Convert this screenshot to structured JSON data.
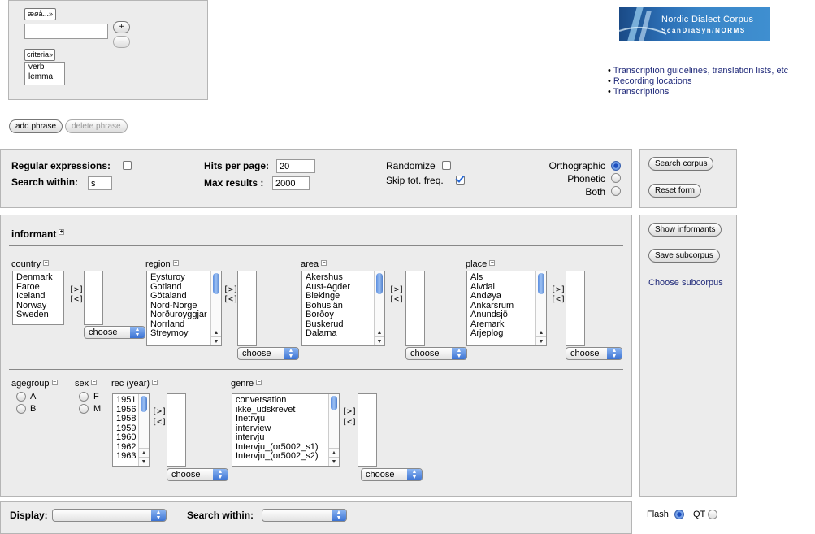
{
  "top": {
    "chars_button": "æøå...»",
    "plus": "+",
    "minus": "−",
    "criteria_button": "criteria»",
    "criteria_items": [
      "verb",
      "lemma"
    ],
    "add_phrase": "add phrase",
    "delete_phrase": "delete phrase"
  },
  "logo": {
    "title": "Nordic Dialect Corpus",
    "subtitle": "ScanDiaSyn/NORMS"
  },
  "links": [
    "Transcription guidelines, translation lists, etc",
    "Recording locations",
    "Transcriptions"
  ],
  "options": {
    "regex_label": "Regular expressions:",
    "search_within_label": "Search within:",
    "search_within_value": "s",
    "hits_label": "Hits per page:",
    "hits_value": "20",
    "max_label": "Max results :",
    "max_value": "2000",
    "randomize_label": "Randomize",
    "skip_label": "Skip tot. freq.",
    "orthographic_label": "Orthographic",
    "phonetic_label": "Phonetic",
    "both_label": "Both"
  },
  "side": {
    "search_corpus": "Search corpus",
    "reset_form": "Reset form",
    "show_informants": "Show informants",
    "save_subcorpus": "Save subcorpus",
    "choose_subcorpus": "Choose subcorpus"
  },
  "informant": {
    "title": "informant",
    "move_right": "[>]",
    "move_left": "[<]",
    "choose_label": "choose",
    "country": {
      "label": "country",
      "items": [
        "Denmark",
        "Faroe",
        "Iceland",
        "Norway",
        "Sweden"
      ]
    },
    "region": {
      "label": "region",
      "items": [
        "Eysturoy",
        "Gotland",
        "Götaland",
        "Nord-Norge",
        "Norðuroyggjar",
        "Norrland",
        "Streymoy"
      ]
    },
    "area": {
      "label": "area",
      "items": [
        "Akershus",
        "Aust-Agder",
        "Blekinge",
        "Bohuslän",
        "Borðoy",
        "Buskerud",
        "Dalarna"
      ]
    },
    "place": {
      "label": "place",
      "items": [
        "Als",
        "Alvdal",
        "Andøya",
        "Ankarsrum",
        "Anundsjö",
        "Aremark",
        "Arjeplog"
      ]
    },
    "agegroup": {
      "label": "agegroup",
      "options": [
        "A",
        "B"
      ]
    },
    "sex": {
      "label": "sex",
      "options": [
        "F",
        "M"
      ]
    },
    "rec": {
      "label": "rec (year)",
      "items": [
        "1951",
        "1956",
        "1958",
        "1959",
        "1960",
        "1962",
        "1963"
      ]
    },
    "genre": {
      "label": "genre",
      "items": [
        "conversation",
        "ikke_udskrevet",
        "Inetrvju",
        "interview",
        "intervju",
        "Intervju_(or5002_s1)",
        "Intervju_(or5002_s2)"
      ]
    }
  },
  "display": {
    "display_label": "Display:",
    "search_within_label": "Search within:",
    "flash_label": "Flash",
    "qt_label": "QT"
  },
  "colors": {
    "panel_bg": "#ececec",
    "link": "#202a7a",
    "accent": "#3b73d3"
  }
}
